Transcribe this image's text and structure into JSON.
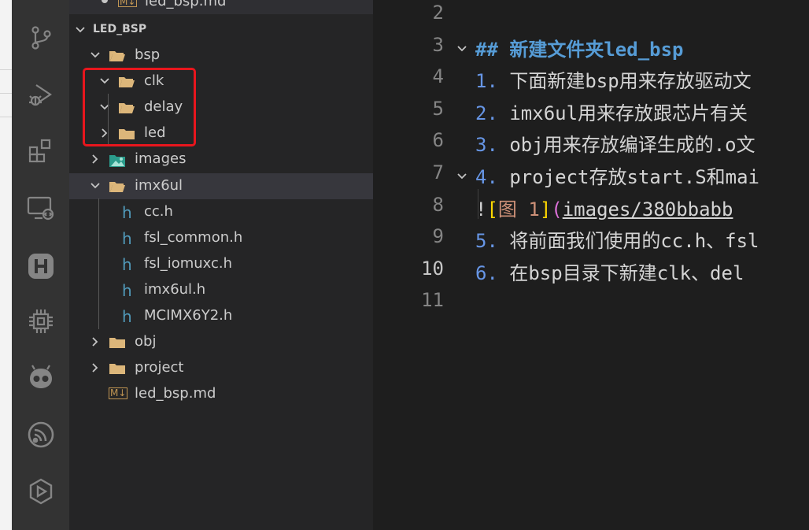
{
  "explorer": {
    "top_file": "led_bsp.md",
    "section_title": "LED_BSP",
    "items": [
      {
        "label": "bsp",
        "kind": "folder",
        "state": "open"
      },
      {
        "label": "clk",
        "kind": "folder",
        "state": "open"
      },
      {
        "label": "delay",
        "kind": "folder",
        "state": "open"
      },
      {
        "label": "led",
        "kind": "folder",
        "state": "closed"
      },
      {
        "label": "images",
        "kind": "image-folder",
        "state": "closed"
      },
      {
        "label": "imx6ul",
        "kind": "folder",
        "state": "open"
      },
      {
        "label": "cc.h",
        "kind": "header-file"
      },
      {
        "label": "fsl_common.h",
        "kind": "header-file"
      },
      {
        "label": "fsl_iomuxc.h",
        "kind": "header-file"
      },
      {
        "label": "imx6ul.h",
        "kind": "header-file"
      },
      {
        "label": "MCIMX6Y2.h",
        "kind": "header-file"
      },
      {
        "label": "obj",
        "kind": "folder",
        "state": "closed"
      },
      {
        "label": "project",
        "kind": "folder",
        "state": "closed"
      },
      {
        "label": "led_bsp.md",
        "kind": "markdown-file"
      }
    ],
    "header_file_glyph": "h",
    "markdown_badge": "M↓"
  },
  "colors": {
    "folder": "#dcb67a",
    "header_icon": "#519aba",
    "highlight_box": "#e8161d",
    "heading": "#569cd6"
  },
  "editor": {
    "lines": [
      {
        "num": "2",
        "parts": []
      },
      {
        "num": "3",
        "parts": [
          {
            "t": "## 新建文件夹led_bsp",
            "c": "c-head"
          }
        ]
      },
      {
        "num": "4",
        "parts": [
          {
            "t": "1.",
            "c": "c-num"
          },
          {
            "t": " 下面新建bsp用来存放驱动文",
            "c": ""
          }
        ]
      },
      {
        "num": "5",
        "parts": [
          {
            "t": "2.",
            "c": "c-num"
          },
          {
            "t": "  imx6ul用来存放跟芯片有关",
            "c": ""
          }
        ]
      },
      {
        "num": "6",
        "parts": [
          {
            "t": "3.",
            "c": "c-num"
          },
          {
            "t": "  obj用来存放编译生成的.o文",
            "c": ""
          }
        ]
      },
      {
        "num": "7",
        "parts": [
          {
            "t": "4.",
            "c": "c-num"
          },
          {
            "t": "  project存放start.S和mai",
            "c": ""
          }
        ]
      },
      {
        "num": "8",
        "parts": [
          {
            "t": "   !",
            "c": ""
          },
          {
            "t": "[",
            "c": "c-bracket"
          },
          {
            "t": "图 1",
            "c": "c-alt"
          },
          {
            "t": "]",
            "c": "c-bracket"
          },
          {
            "t": "(",
            "c": "c-paren"
          },
          {
            "t": "images/380bbabb",
            "c": "c-link"
          }
        ]
      },
      {
        "num": "9",
        "parts": [
          {
            "t": "5.",
            "c": "c-num"
          },
          {
            "t": "  将前面我们使用的cc.h、fsl",
            "c": ""
          }
        ]
      },
      {
        "num": "10",
        "parts": [
          {
            "t": "6.",
            "c": "c-num"
          },
          {
            "t": "  在bsp目录下新建clk、del",
            "c": ""
          }
        ]
      },
      {
        "num": "11",
        "parts": []
      }
    ]
  }
}
